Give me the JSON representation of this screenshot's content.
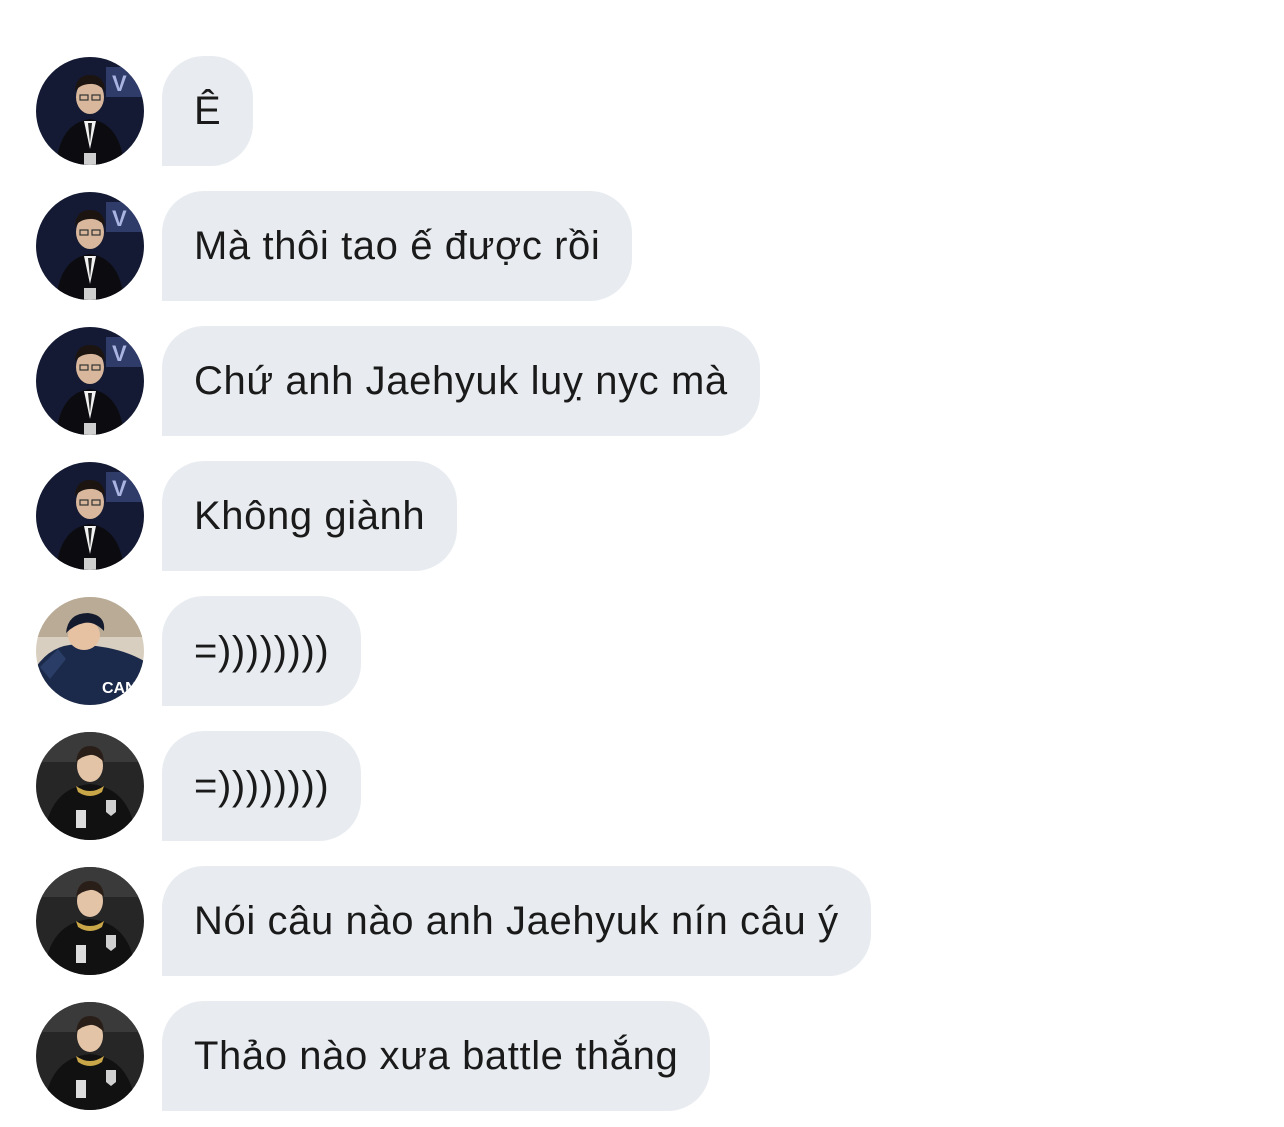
{
  "chat": {
    "messages": [
      {
        "sender_avatar": "suit-man-avatar",
        "text": "Ê"
      },
      {
        "sender_avatar": "suit-man-avatar",
        "text": "Mà thôi tao ế được rồi"
      },
      {
        "sender_avatar": "suit-man-avatar",
        "text": "Chứ anh Jaehyuk luỵ nyc mà"
      },
      {
        "sender_avatar": "suit-man-avatar",
        "text": "Không giành"
      },
      {
        "sender_avatar": "canyon-jersey-avatar",
        "text": "=))))))))",
        "avatar_jersey_text": "CANY"
      },
      {
        "sender_avatar": "gen-g-jersey-avatar",
        "text": "=))))))))"
      },
      {
        "sender_avatar": "gen-g-jersey-avatar",
        "text": "Nói câu nào anh Jaehyuk nín câu ý"
      },
      {
        "sender_avatar": "gen-g-jersey-avatar",
        "text": "Thảo nào xưa battle thắng"
      }
    ]
  },
  "colors": {
    "bubble_bg": "#e8ecf0",
    "text": "#1a1a1a",
    "page_bg": "#ffffff"
  }
}
